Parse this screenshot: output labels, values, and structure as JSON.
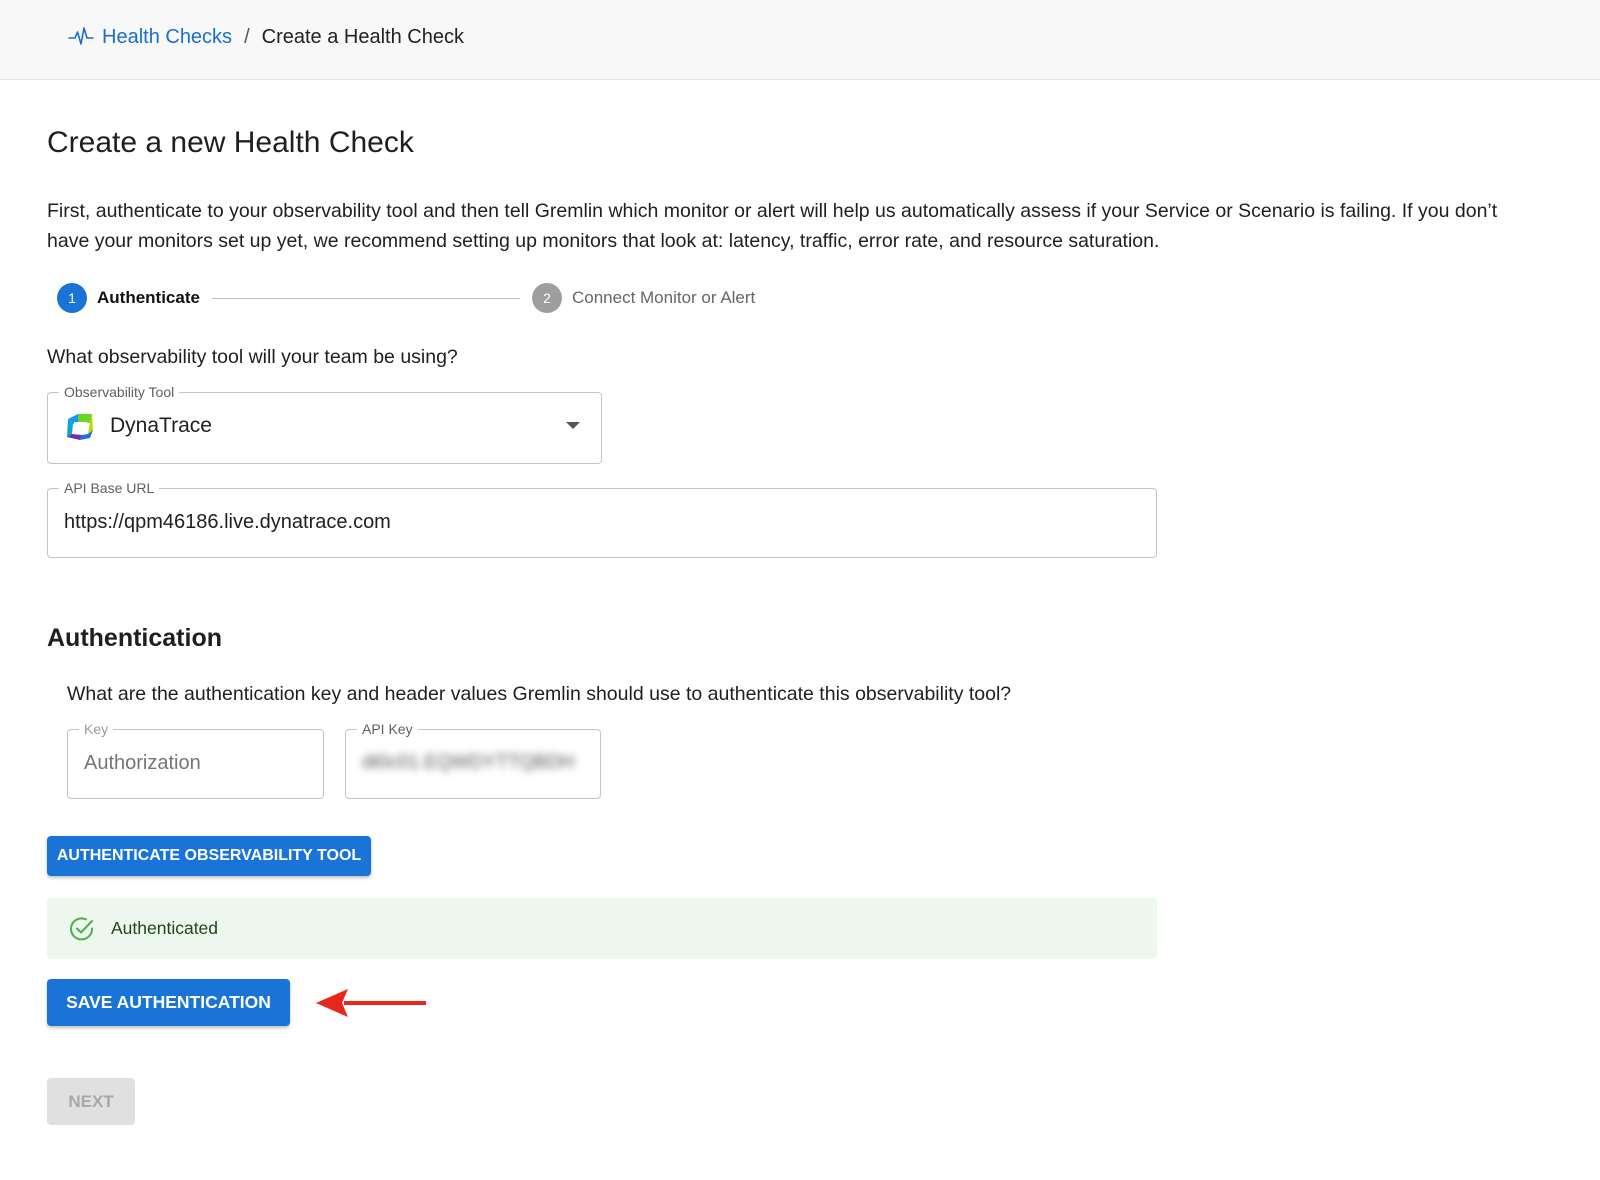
{
  "breadcrumb": {
    "icon": "heartbeat-icon",
    "link_label": "Health Checks",
    "separator": "/",
    "current_label": "Create a Health Check"
  },
  "page": {
    "title": "Create a new Health Check",
    "intro": "First, authenticate to your observability tool and then tell Gremlin which monitor or alert will help us automatically assess if your Service or Scenario is failing. If you don’t have your monitors set up yet, we recommend setting up monitors that look at: latency, traffic, error rate, and resource saturation."
  },
  "stepper": {
    "steps": [
      {
        "number": "1",
        "label": "Authenticate",
        "state": "active"
      },
      {
        "number": "2",
        "label": "Connect Monitor or Alert",
        "state": "inactive"
      }
    ]
  },
  "tool_section": {
    "question": "What observability tool will your team be using?",
    "tool_field": {
      "label": "Observability Tool",
      "value": "DynaTrace",
      "icon": "dynatrace-logo-icon"
    },
    "url_field": {
      "label": "API Base URL",
      "value": "https://qpm46186.live.dynatrace.com"
    }
  },
  "auth_section": {
    "heading": "Authentication",
    "question": "What are the authentication key and header values Gremlin should use to authenticate this observability tool?",
    "key_field": {
      "label": "Key",
      "placeholder": "Authorization"
    },
    "api_key_field": {
      "label": "API Key",
      "value": "dt0c01.EQWDYTTQBDH"
    },
    "authenticate_button": "Authenticate Observability Tool",
    "alert": {
      "icon": "check-circle-icon",
      "text": "Authenticated"
    },
    "save_button": "Save Authentication",
    "next_button": "Next"
  },
  "colors": {
    "primary": "#1a73d6",
    "success_bg": "#edf7ed",
    "success_icon": "#4caf50",
    "annotation_arrow": "#e8261a"
  }
}
